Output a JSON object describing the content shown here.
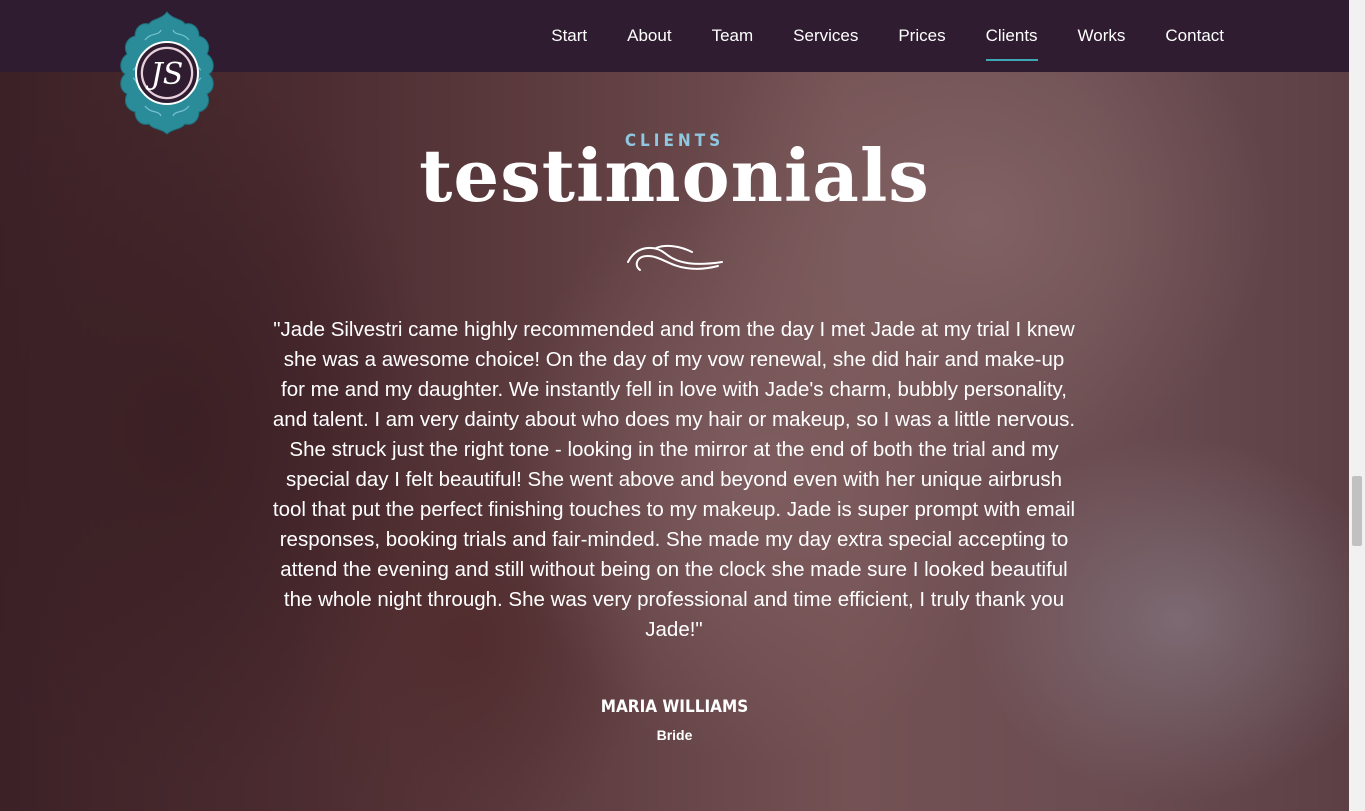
{
  "nav": {
    "items": [
      {
        "label": "Start"
      },
      {
        "label": "About"
      },
      {
        "label": "Team"
      },
      {
        "label": "Services"
      },
      {
        "label": "Prices"
      },
      {
        "label": "Clients",
        "active": true
      },
      {
        "label": "Works"
      },
      {
        "label": "Contact"
      }
    ],
    "active_color": "#3da7b4",
    "bar_color": "#2f1c31"
  },
  "logo": {
    "monogram": "JS",
    "icon": "ornamental-monogram-logo",
    "frame_color": "#2a8b99"
  },
  "section": {
    "eyebrow": "CLIENTS",
    "title": "testimonials",
    "divider_icon": "swirl-divider-icon"
  },
  "testimonial": {
    "quote": "\"Jade Silvestri came highly recommended and from the day I met Jade at my trial I knew she was a awesome choice! On the day of my vow renewal, she did hair and make-up for me and my daughter. We instantly fell in love with Jade's charm, bubbly personality, and talent. I am very dainty about who does my hair or makeup, so I was a little nervous. She struck just the right tone - looking in the mirror at the end of both the trial and my special day I felt beautiful! She went above and beyond even with her unique airbrush tool that put the perfect finishing touches to my makeup. Jade is super prompt with email responses, booking trials and fair-minded. She made my day extra special accepting to attend the evening and still without being on the clock she made sure I looked beautiful the whole night through. She was very professional and time efficient, I truly thank you Jade!\"",
    "author": "MARIA WILLIAMS",
    "role": "Bride"
  },
  "colors": {
    "eyebrow": "#8fc7e0",
    "text": "#ffffff"
  }
}
